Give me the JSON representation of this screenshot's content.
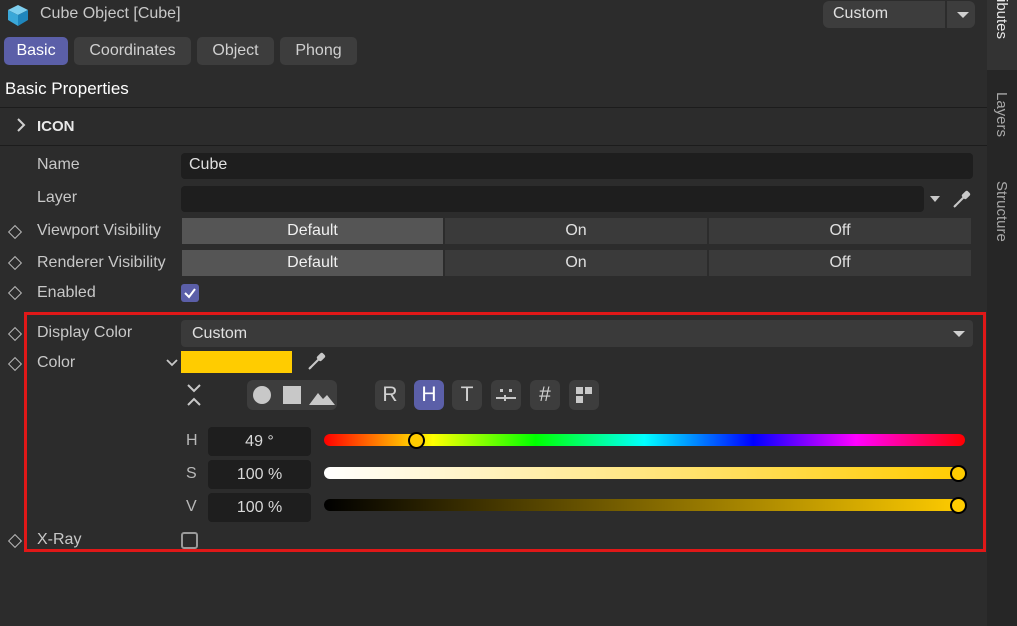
{
  "header": {
    "title": "Cube Object [Cube]",
    "mode_value": "Custom"
  },
  "tabs": [
    {
      "label": "Basic",
      "active": true
    },
    {
      "label": "Coordinates",
      "active": false
    },
    {
      "label": "Object",
      "active": false
    },
    {
      "label": "Phong",
      "active": false
    }
  ],
  "section_title": "Basic Properties",
  "group": {
    "label": "ICON"
  },
  "fields": {
    "name": {
      "label": "Name",
      "value": "Cube"
    },
    "layer": {
      "label": "Layer",
      "value": ""
    },
    "viewport_visibility": {
      "label": "Viewport Visibility",
      "options": [
        "Default",
        "On",
        "Off"
      ],
      "selected": "Default"
    },
    "renderer_visibility": {
      "label": "Renderer Visibility",
      "options": [
        "Default",
        "On",
        "Off"
      ],
      "selected": "Default"
    },
    "enabled": {
      "label": "Enabled",
      "checked": true
    },
    "display_color": {
      "label": "Display Color",
      "value": "Custom"
    },
    "color": {
      "label": "Color",
      "swatch": "#ffcc00"
    },
    "xray": {
      "label": "X-Ray",
      "checked": false
    }
  },
  "color_picker": {
    "mode_buttons": [
      "R",
      "H",
      "T"
    ],
    "selected_mode": "H",
    "hex_label": "#",
    "channels": [
      {
        "label": "H",
        "value": "49 °",
        "fraction": 0.136
      },
      {
        "label": "S",
        "value": "100 %",
        "fraction": 1.0
      },
      {
        "label": "V",
        "value": "100 %",
        "fraction": 1.0
      }
    ]
  },
  "side_tabs": [
    "ributes",
    "Layers",
    "Structure"
  ],
  "colors": {
    "accent": "#5b5fa8",
    "highlight": "#e01818",
    "color_value": "#ffcc00"
  }
}
